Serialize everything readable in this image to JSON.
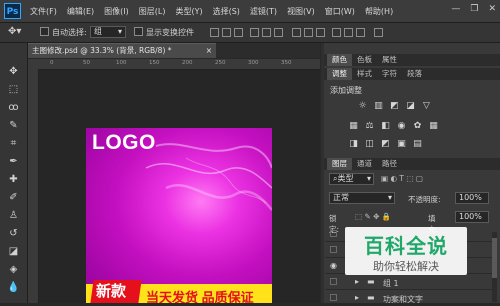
{
  "app": {
    "logo": "Ps"
  },
  "menu": [
    "文件(F)",
    "编辑(E)",
    "图像(I)",
    "图层(L)",
    "类型(Y)",
    "选择(S)",
    "滤镜(T)",
    "视图(V)",
    "窗口(W)",
    "帮助(H)"
  ],
  "window_controls": {
    "minimize": "—",
    "restore": "❐",
    "close": "✕"
  },
  "options": {
    "auto_select_label": "自动选择:",
    "auto_select_value": "组",
    "show_transform_label": "显示变换控件"
  },
  "document_tab": {
    "title": "主图修改.psd @ 33.3% (背景, RGB/8) *",
    "close": "×"
  },
  "ruler_numbers": [
    "0",
    "50",
    "100",
    "150",
    "200",
    "250",
    "300",
    "350"
  ],
  "canvas": {
    "logo_text": "LOGO",
    "banner_new": "新款",
    "banner_slogan": "当天发货 品质保证",
    "colors": {
      "magenta": "#c410c0",
      "banner": "#ffe21a",
      "red": "#e4101c"
    }
  },
  "panel_top_tabs": [
    "颜色",
    "色板",
    "属性"
  ],
  "adjust_tabs": [
    "调整",
    "样式",
    "字符",
    "段落"
  ],
  "adjust": {
    "add_label": "添加调整"
  },
  "layers_tabs": [
    "图层",
    "通道",
    "路径"
  ],
  "layers": {
    "filter_kind": "类型",
    "blend_mode": "正常",
    "opacity_label": "不透明度:",
    "opacity_value": "100%",
    "lock_label": "锁定:",
    "fill_label": "填充:",
    "fill_value": "100%",
    "rows": [
      {
        "name": "",
        "visible": false
      },
      {
        "name": "",
        "visible": false
      },
      {
        "name": "",
        "visible": true
      },
      {
        "name": "组 1",
        "visible": false
      },
      {
        "name": "功案和文字",
        "visible": false
      }
    ]
  },
  "watermark": {
    "title": "百科全说",
    "subtitle": "助你轻松解决"
  }
}
